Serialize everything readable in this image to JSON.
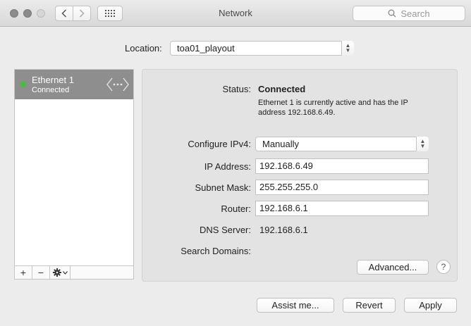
{
  "window": {
    "title": "Network"
  },
  "toolbar": {
    "back_icon": "chevron-left-icon",
    "forward_icon": "chevron-right-icon",
    "show_all_icon": "grid-icon",
    "search_placeholder": "Search"
  },
  "location": {
    "label": "Location:",
    "value": "toa01_playout"
  },
  "services": [
    {
      "name": "Ethernet 1",
      "status": "Connected",
      "status_color": "#3ec43a"
    }
  ],
  "sidebar_controls": {
    "add": "+",
    "remove": "−",
    "action_icon": "gear-icon"
  },
  "detail": {
    "status_label": "Status:",
    "status_value": "Connected",
    "status_description_line1": "Ethernet 1 is currently active and has the IP",
    "status_description_line2": "address 192.168.6.49.",
    "configure_label": "Configure IPv4:",
    "configure_value": "Manually",
    "ip_label": "IP Address:",
    "ip_value": "192.168.6.49",
    "subnet_label": "Subnet Mask:",
    "subnet_value": "255.255.255.0",
    "router_label": "Router:",
    "router_value": "192.168.6.1",
    "dns_label": "DNS Server:",
    "dns_value": "192.168.6.1",
    "search_domains_label": "Search Domains:",
    "advanced_label": "Advanced...",
    "help_label": "?"
  },
  "footer": {
    "assist_label": "Assist me...",
    "revert_label": "Revert",
    "apply_label": "Apply"
  }
}
